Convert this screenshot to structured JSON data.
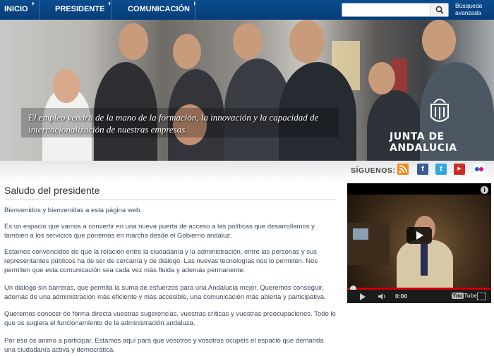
{
  "nav": {
    "items": [
      {
        "label": "INICIO"
      },
      {
        "label": "PRESIDENTE"
      },
      {
        "label": "COMUNICACIÓN"
      }
    ],
    "search_placeholder": "",
    "advanced_search": "Búsqueda avanzada"
  },
  "hero": {
    "caption": "El empleo vendrá de la mano de la formación, la innovación y la capacidad de internacionalización de nuestras empresas.",
    "brand": "JUNTA DE ANDALUCIA"
  },
  "social": {
    "label": "SÍGUENOS:",
    "icons": [
      "rss-icon",
      "facebook-icon",
      "twitter-icon",
      "youtube-icon",
      "flickr-icon"
    ],
    "colors": {
      "rss": "#f28a1e",
      "facebook": "#3b5998",
      "twitter": "#33a8e0",
      "youtube": "#d12a22",
      "flickr": "#ffffff"
    }
  },
  "content": {
    "title": "Saludo del presidente",
    "paragraphs": [
      "Bienvenidos y bienvenidas a esta página web.",
      "Es un espacio que vamos a convertir en una nueva puerta de acceso a las políticas que desarrollamos y también a los servicios que ponemos en marcha desde el Gobierno andaluz.",
      "Estamos convencidos de que la relación entre la ciudadanía y la administración, entre las personas y sus representantes públicos ha de ser de cercanía y de diálogo. Las nuevas tecnologías nos lo permiten. Nos permiten que esta comunicación sea cada vez más fluida y además permanente.",
      "Un diálogo sin barreras, que permita la suma de esfuerzos para una Andalucía mejor. Queremos conseguir, además de una administración más eficiente y más accesible, una comunicación más abierta y participativa.",
      "Queremos conocer de forma directa vuestras sugerencias, vuestras críticas y vuestras preocupaciones. Todo lo que os sugiera el funcionamiento de la administración andaluza.",
      "Por eso os animo a participar. Estamos aquí para que vosotros y vosotras ocupéis el espacio que demanda una ciudadanía activa y democrática."
    ]
  },
  "video": {
    "time": "0:00",
    "brand": "You",
    "brand_tube": "Tube",
    "info": "i"
  },
  "colors": {
    "nav_bg": "#0b4c8f",
    "text": "#3c4a5c",
    "progress": "#cc0000"
  }
}
